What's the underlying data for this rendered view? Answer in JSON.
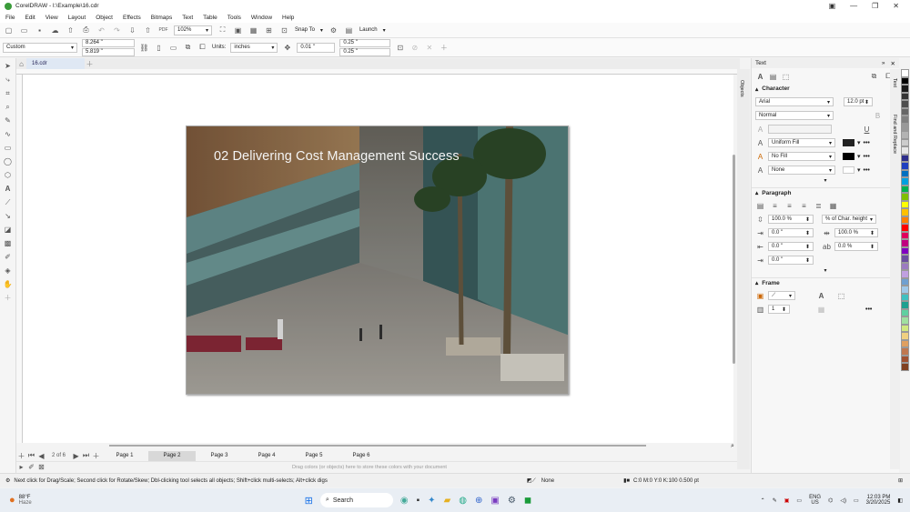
{
  "window": {
    "title": "CorelDRAW - I:\\Example\\16.cdr"
  },
  "menu": [
    "File",
    "Edit",
    "View",
    "Layout",
    "Object",
    "Effects",
    "Bitmaps",
    "Text",
    "Table",
    "Tools",
    "Window",
    "Help"
  ],
  "toolbar": {
    "zoom": "102%",
    "snap_label": "Snap To",
    "launch_label": "Launch"
  },
  "property_bar": {
    "page_size": "Custom",
    "width": "8.264 \"",
    "height": "5.819 \"",
    "units_label": "Units:",
    "units": "inches",
    "nudge": "0.01 \"",
    "dup_x": "0.25 \"",
    "dup_y": "0.25 \""
  },
  "document_tab": "16.cdr",
  "slide": {
    "title": "02 Delivering Cost Management Success"
  },
  "pages": {
    "counter": "2 of 6",
    "tabs": [
      "Page 1",
      "Page 2",
      "Page 3",
      "Page 4",
      "Page 5",
      "Page 6"
    ],
    "active_index": 1
  },
  "color_hint": "Drag colors (or objects) here to store these colors with your document",
  "status": {
    "hint": "Next click for Drag/Scale; Second click for Rotate/Skew; Dbl-clicking tool selects all objects; Shift+click multi-selects; Alt+click digs",
    "fill_label": "None",
    "color_info": "C:0 M:0 Y:0 K:100  0.500 pt"
  },
  "docker": {
    "title": "Text",
    "character_label": "Character",
    "font": "Arial",
    "size": "12.0 pt",
    "style": "Normal",
    "fill_type": "Uniform Fill",
    "bg_fill": "No Fill",
    "outline": "None",
    "paragraph_label": "Paragraph",
    "line_spacing": "100.0 %",
    "spacing_unit": "% of Char. height",
    "indent1": "0.0 \"",
    "indent2": "0.0 \"",
    "indent3": "0.0 \"",
    "char_spacing": "100.0 %",
    "word_spacing": "0.0 %",
    "frame_label": "Frame",
    "columns": "1"
  },
  "side_tabs": {
    "objects": "Objects",
    "text": "Text",
    "find": "Find and Replace"
  },
  "taskbar": {
    "temp": "88°F",
    "weather": "Haze",
    "search": "Search",
    "lang1": "ENG",
    "lang2": "US",
    "time": "12:03 PM",
    "date": "3/20/2025"
  },
  "palette_colors": [
    "#ffffff",
    "#000000",
    "#1a1a1a",
    "#333333",
    "#4d4d4d",
    "#666666",
    "#808080",
    "#999999",
    "#b3b3b3",
    "#cccccc",
    "#e6e6e6",
    "#2d2d8a",
    "#1f3fbf",
    "#0070c0",
    "#00a0e0",
    "#00b050",
    "#7fc000",
    "#ffff00",
    "#ffc000",
    "#ff7f00",
    "#ff0000",
    "#e0005c",
    "#c00080",
    "#8000c0",
    "#6a4fa0",
    "#9b7bc0",
    "#c0a0e0",
    "#70a0d0",
    "#a0c8e8",
    "#40c0c0",
    "#20a090",
    "#60d0a0",
    "#a0e0a0",
    "#d0e880",
    "#f0d080",
    "#e0a060",
    "#c07850",
    "#a05030",
    "#804020"
  ]
}
